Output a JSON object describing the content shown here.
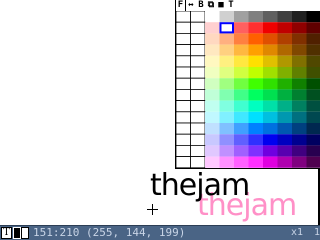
{
  "toolbar": {
    "tools": [
      {
        "label": "F",
        "icon": "fill-icon"
      },
      {
        "label": "↔",
        "icon": "swap-icon"
      },
      {
        "label": "B",
        "icon": "brush-icon"
      },
      {
        "label": "⧉",
        "icon": "copy-icon"
      },
      {
        "label": "■",
        "icon": "rect-icon"
      },
      {
        "label": "T",
        "icon": "text-tool-icon"
      }
    ]
  },
  "palette": {
    "selected_index": {
      "row": 1,
      "col": 3
    },
    "rows": [
      [
        "#ffffff",
        "#ffffff",
        "#ffffff",
        "#d0d0d0",
        "#a0a0a0",
        "#808080",
        "#606060",
        "#404040",
        "#202020",
        "#000000"
      ],
      [
        "#ffffff",
        "#ffffff",
        "#ffd0d0",
        "#ffffff",
        "#ff6060",
        "#ff3030",
        "#f00000",
        "#c00000",
        "#900000",
        "#600000"
      ],
      [
        "#ffffff",
        "#ffffff",
        "#ffd8c0",
        "#ffb080",
        "#ff8040",
        "#ff6000",
        "#e05000",
        "#b04000",
        "#803000",
        "#502000"
      ],
      [
        "#ffffff",
        "#ffffff",
        "#ffe8c0",
        "#ffd080",
        "#ffb840",
        "#ffa000",
        "#e08800",
        "#b06800",
        "#804800",
        "#503000"
      ],
      [
        "#ffffff",
        "#ffffff",
        "#fff8c0",
        "#fff080",
        "#ffe840",
        "#ffe000",
        "#e0c000",
        "#b09800",
        "#807000",
        "#504800"
      ],
      [
        "#ffffff",
        "#ffffff",
        "#f0ffc0",
        "#e0ff80",
        "#d0ff40",
        "#c0ff00",
        "#a0e000",
        "#80b000",
        "#608000",
        "#405000"
      ],
      [
        "#ffffff",
        "#ffffff",
        "#d0ffc0",
        "#a0ff80",
        "#70ff40",
        "#40ff00",
        "#30e000",
        "#20b000",
        "#108000",
        "#005000"
      ],
      [
        "#ffffff",
        "#ffffff",
        "#c0ffd8",
        "#80ffb0",
        "#40ff88",
        "#00ff60",
        "#00e050",
        "#00b040",
        "#008030",
        "#005020"
      ],
      [
        "#ffffff",
        "#ffffff",
        "#c0fff0",
        "#80ffe0",
        "#40ffd0",
        "#00ffc0",
        "#00e0a8",
        "#00b088",
        "#008060",
        "#005040"
      ],
      [
        "#ffffff",
        "#ffffff",
        "#c0f8ff",
        "#80f0ff",
        "#40e8ff",
        "#00e0ff",
        "#00c0e0",
        "#0098b0",
        "#007080",
        "#004850"
      ],
      [
        "#ffffff",
        "#ffffff",
        "#c0e0ff",
        "#80c0ff",
        "#40a0ff",
        "#0080ff",
        "#0070e0",
        "#0058b0",
        "#004080",
        "#002850"
      ],
      [
        "#ffffff",
        "#ffffff",
        "#c8c8ff",
        "#9090ff",
        "#6060ff",
        "#3030ff",
        "#0000f0",
        "#0000c0",
        "#000090",
        "#000060"
      ],
      [
        "#ffffff",
        "#ffffff",
        "#e0c8ff",
        "#c090ff",
        "#a060ff",
        "#8030ff",
        "#7000e0",
        "#5800b0",
        "#400080",
        "#280050"
      ],
      [
        "#ffffff",
        "#ffffff",
        "#ffc8ff",
        "#ff90ff",
        "#ff60ff",
        "#ff30ff",
        "#e000e0",
        "#b000b0",
        "#800080",
        "#500050"
      ]
    ]
  },
  "canvas": {
    "text_primary": "thejam",
    "text_shadow": "thejam",
    "primary_color": "#000000",
    "shadow_color": "#ff90c7"
  },
  "status": {
    "text_tool_label": "T",
    "position_and_color": "151:210 (255, 144, 199)",
    "zoom": "x1",
    "page": "1",
    "bar_color": "#4a6485"
  }
}
